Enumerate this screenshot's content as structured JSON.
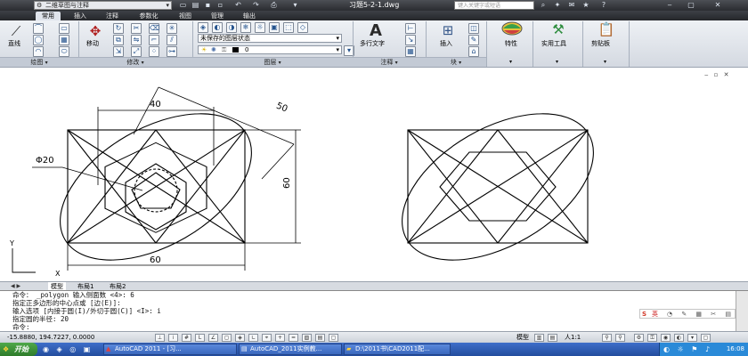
{
  "title_bar": {
    "workspace": "二维草图与注释",
    "filename": "习题5-2-1.dwg",
    "search_placeholder": "键入关键字或短语"
  },
  "ribbon_tabs": [
    "常用",
    "插入",
    "注释",
    "参数化",
    "视图",
    "管理",
    "输出"
  ],
  "ribbon": {
    "draw": {
      "line_label": "直线",
      "panel": "绘图"
    },
    "modify": {
      "move_label": "移动",
      "panel": "修改"
    },
    "layers": {
      "state": "未保存的图层状态",
      "current_layer": "0",
      "panel": "图层"
    },
    "annotation": {
      "mtext_label": "多行文字",
      "panel": "注释"
    },
    "block": {
      "insert_label": "插入",
      "panel": "块"
    },
    "properties": {
      "label": "特性"
    },
    "utilities": {
      "label": "实用工具"
    },
    "clipboard": {
      "label": "剪贴板"
    }
  },
  "drawing": {
    "dim_top": "40",
    "dim_diag": "50",
    "dim_right": "60",
    "dim_bottom": "60",
    "dim_circle": "Φ20",
    "ucs_x": "X",
    "ucs_y": "Y"
  },
  "layout_tabs": [
    "模型",
    "布局1",
    "布局2"
  ],
  "command_lines": [
    "命令： _polygon 输入侧面数 <4>: 6",
    "指定正多边形的中心点或 [边(E)]:",
    "输入选项 [内接于圆(I)/外切于圆(C)] <I>: i",
    "指定圆的半径: 20",
    "命令:"
  ],
  "ime": {
    "label": "英"
  },
  "status": {
    "coords": "-15.8880, 194.7227, 0.0000",
    "model": "模型",
    "scale": "人1:1"
  },
  "taskbar": {
    "start": "开始",
    "tasks": [
      "AutoCAD 2011 - [习...",
      "AutoCAD_2011实例教...",
      "D:\\2011书\\CAD2011配..."
    ],
    "clock": "16:08"
  }
}
